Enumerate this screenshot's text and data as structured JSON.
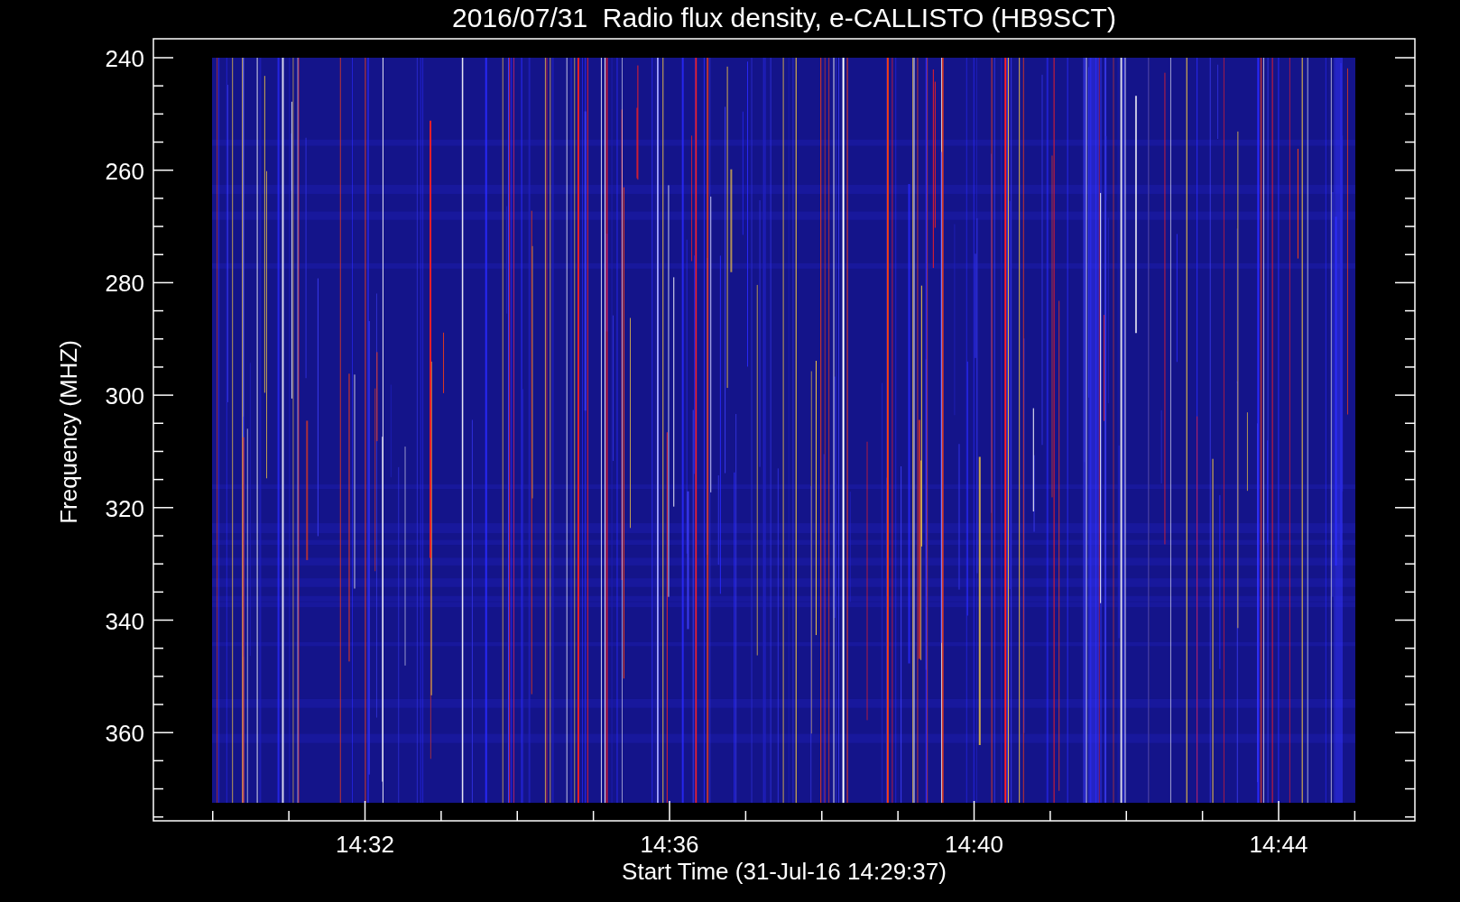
{
  "title": "2016/07/31  Radio flux density, e-CALLISTO (HB9SCT)",
  "y_axis": {
    "label": "Frequency (MHZ)",
    "ticks": [
      "240",
      "260",
      "280",
      "300",
      "320",
      "340",
      "360"
    ]
  },
  "x_axis": {
    "label": "Start Time (31-Jul-16 14:29:37)",
    "ticks": [
      "14:32",
      "14:36",
      "14:40",
      "14:44"
    ]
  }
}
